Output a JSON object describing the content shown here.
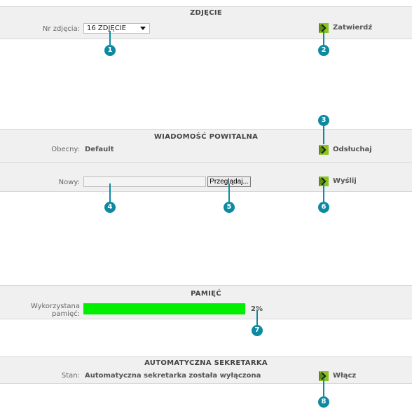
{
  "sections": {
    "photo": {
      "title": "ZDJĘCIE",
      "number_label": "Nr zdjęcia:",
      "select_value": "16 ZDJĘCIE",
      "confirm_label": "Zatwierdź"
    },
    "greeting": {
      "title": "WIADOMOŚĆ POWITALNA",
      "current_label": "Obecny:",
      "current_value": "Default",
      "listen_label": "Odsłuchaj",
      "new_label": "Nowy:",
      "browse_label": "Przeglądaj...",
      "send_label": "Wyślij"
    },
    "memory": {
      "title": "PAMIĘĆ",
      "used_label_line1": "Wykorzystana",
      "used_label_line2": "pamięć:",
      "used_percent": 2,
      "used_text": "2%"
    },
    "answering_machine": {
      "title": "AUTOMATYCZNA SEKRETARKA",
      "status_label": "Stan:",
      "status_value": "Automatyczna sekretarka została wyłączona",
      "enable_label": "Włącz"
    }
  },
  "callouts": [
    "1",
    "2",
    "3",
    "4",
    "5",
    "6",
    "7",
    "8"
  ],
  "colors": {
    "callout": "#0e8aa0",
    "bar_fill": "#00ee00",
    "panel_bg": "#f0f0f0"
  },
  "icons": {
    "action": "green-arrow-icon",
    "dropdown": "triangle-down-icon"
  }
}
